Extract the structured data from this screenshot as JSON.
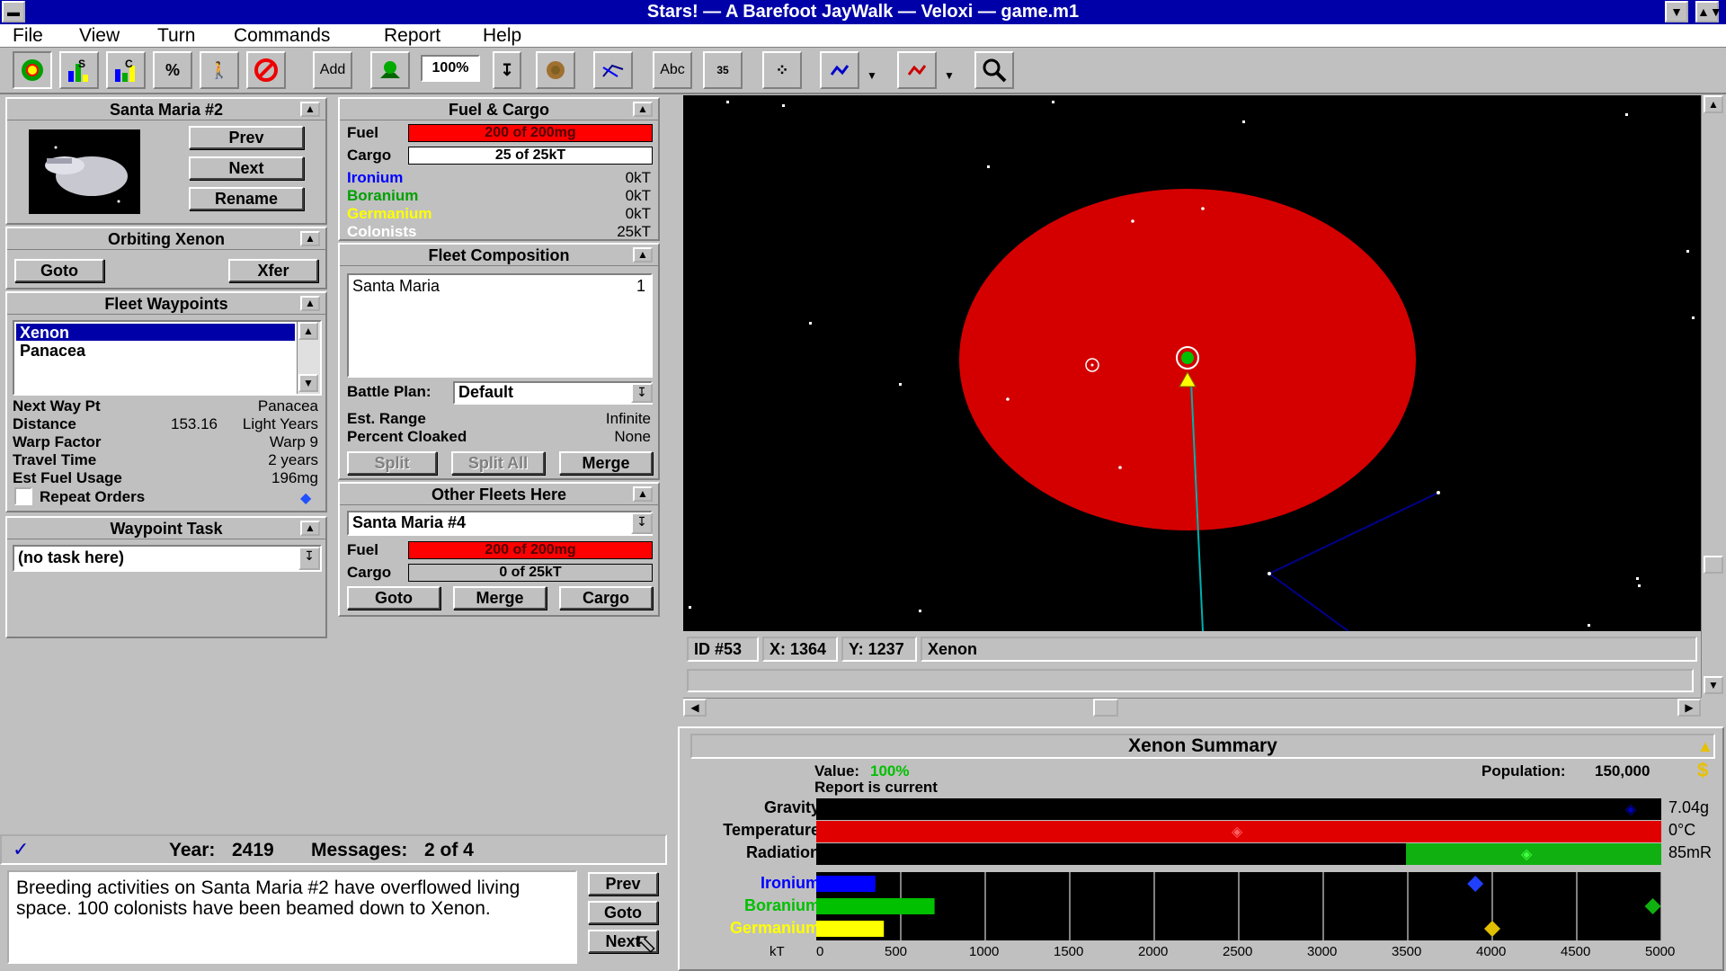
{
  "window": {
    "title": "Stars! — A Barefoot JayWalk — Veloxi — game.m1"
  },
  "menu": [
    "File",
    "View",
    "Turn",
    "Commands",
    "Report",
    "Help"
  ],
  "toolbar": {
    "add_label": "Add",
    "zoom": "100%",
    "abc_label": "Abc",
    "count_label": "35"
  },
  "fleet": {
    "title": "Santa Maria #2",
    "prev": "Prev",
    "next": "Next",
    "rename": "Rename"
  },
  "orbiting": {
    "title": "Orbiting Xenon",
    "goto": "Goto",
    "xfer": "Xfer"
  },
  "waypoints": {
    "title": "Fleet Waypoints",
    "items": [
      "Xenon",
      "Panacea"
    ],
    "next_wp_label": "Next Way Pt",
    "next_wp": "Panacea",
    "distance_label": "Distance",
    "distance": "153.16",
    "distance_unit": "Light Years",
    "warp_label": "Warp Factor",
    "warp": "Warp 9",
    "travel_label": "Travel Time",
    "travel": "2 years",
    "fuel_label": "Est Fuel Usage",
    "fuel": "196mg",
    "repeat_label": "Repeat Orders"
  },
  "task": {
    "title": "Waypoint Task",
    "value": "(no task here)"
  },
  "fuelcargo": {
    "title": "Fuel & Cargo",
    "fuel_label": "Fuel",
    "fuel": "200 of 200mg",
    "fuel_fraction": 1.0,
    "cargo_label": "Cargo",
    "cargo": "25 of 25kT",
    "cargo_fraction": 1.0,
    "ironium_label": "Ironium",
    "ironium": "0kT",
    "boranium_label": "Boranium",
    "boranium": "0kT",
    "germanium_label": "Germanium",
    "germanium": "0kT",
    "colonists_label": "Colonists",
    "colonists": "25kT"
  },
  "composition": {
    "title": "Fleet Composition",
    "ship": "Santa Maria",
    "count": "1",
    "battle_label": "Battle Plan:",
    "battle": "Default",
    "range_label": "Est. Range",
    "range": "Infinite",
    "cloak_label": "Percent Cloaked",
    "cloak": "None",
    "split": "Split",
    "split_all": "Split All",
    "merge": "Merge"
  },
  "other_fleets": {
    "title": "Other Fleets Here",
    "selected": "Santa Maria #4",
    "fuel_label": "Fuel",
    "fuel": "200 of 200mg",
    "fuel_fraction": 1.0,
    "cargo_label": "Cargo",
    "cargo": "0 of 25kT",
    "cargo_fraction": 0.0,
    "goto": "Goto",
    "merge": "Merge",
    "cargo_btn": "Cargo"
  },
  "coords": {
    "id": "ID #53",
    "x": "X: 1364",
    "y": "Y: 1237",
    "name": "Xenon"
  },
  "summary": {
    "title": "Xenon Summary",
    "value_label": "Value:",
    "value": "100%",
    "report": "Report is current",
    "population_label": "Population:",
    "population": "150,000",
    "gravity_label": "Gravity",
    "gravity": "7.04g",
    "temperature_label": "Temperature",
    "temperature": "0°C",
    "radiation_label": "Radiation",
    "radiation": "85mR",
    "ironium_label": "Ironium",
    "boranium_label": "Boranium",
    "germanium_label": "Germanium",
    "axis_unit": "kT",
    "ticks": [
      "0",
      "500",
      "1000",
      "1500",
      "2000",
      "2500",
      "3000",
      "3500",
      "4000",
      "4500",
      "5000"
    ],
    "minerals_kt": {
      "ironium": 350,
      "boranium": 700,
      "germanium": 400
    },
    "concentration_kt": {
      "ironium": 3900,
      "boranium": 4950,
      "germanium": 4000
    }
  },
  "messages": {
    "year_label": "Year:",
    "year": "2419",
    "count_label": "Messages:",
    "count": "2 of 4",
    "text": "Breeding activities on Santa Maria #2 have overflowed living space.  100 colonists have been beamed down to Xenon.",
    "prev": "Prev",
    "goto": "Goto",
    "next": "Next"
  },
  "colors": {
    "title_bar": "#0000a8",
    "fuel_red": "#ff0000",
    "ironium": "#0000ff",
    "boranium": "#00c000",
    "germanium": "#ffff00",
    "planet": "#d40000"
  }
}
